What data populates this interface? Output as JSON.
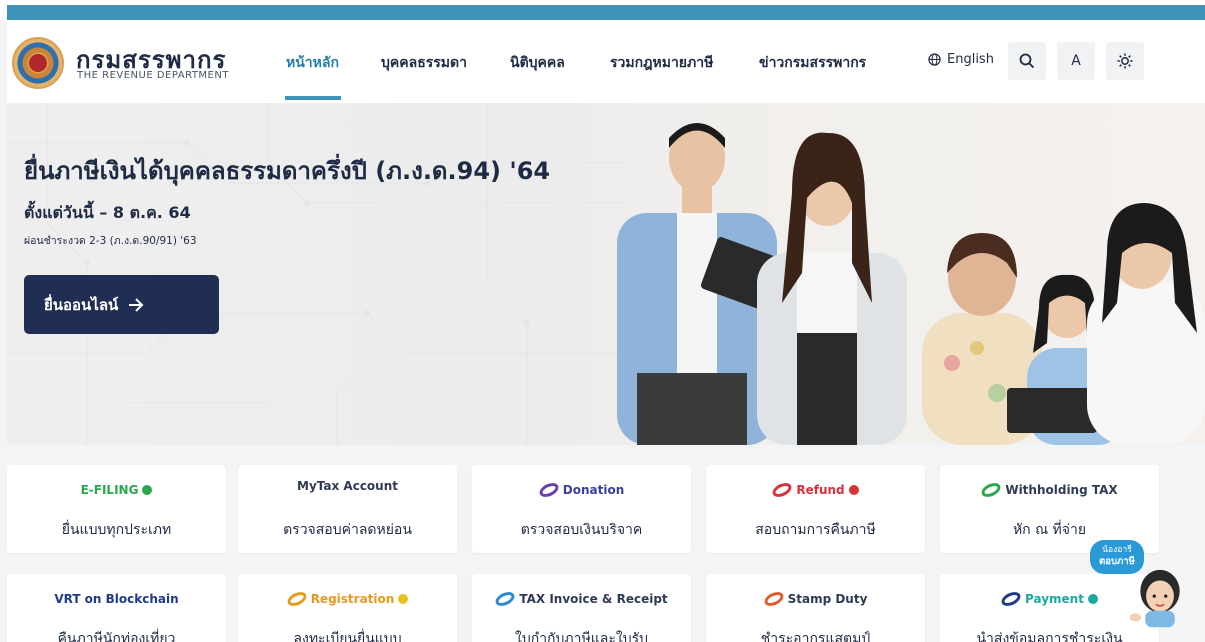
{
  "header": {
    "brand_th": "กรมสรรพากร",
    "brand_en": "THE REVENUE DEPARTMENT",
    "nav": [
      {
        "label": "หน้าหลัก",
        "active": true
      },
      {
        "label": "บุคคลธรรมดา",
        "active": false
      },
      {
        "label": "นิติบุคคล",
        "active": false
      },
      {
        "label": "รวมกฎหมายภาษี",
        "active": false
      },
      {
        "label": "ข่าวกรมสรรพากร",
        "active": false
      }
    ],
    "language_label": "English",
    "font_size_label": "A",
    "icons": [
      "globe-icon",
      "search-icon",
      "brightness-icon"
    ]
  },
  "hero": {
    "title": "ยื่นภาษีเงินได้บุคคลธรรมดาครึ่งปี (ภ.ง.ด.94) '64",
    "subtitle": "ตั้งแต่วันนี้ – 8 ต.ค. 64",
    "note": "ผ่อนชำระงวด 2-3 (ภ.ง.ด.90/91) '63",
    "cta_label": "ยื่นออนไลน์",
    "cta_icon": "arrow-right-icon"
  },
  "services": [
    {
      "brand": "E-FILING",
      "label": "ยื่นแบบทุกประเภท",
      "accent": "#2aa84a"
    },
    {
      "brand": "MyTax Account",
      "label": "ตรวจสอบค่าลดหย่อน",
      "accent": "#e0534a"
    },
    {
      "brand": "Donation",
      "label": "ตรวจสอบเงินบริจาค",
      "accent": "#6a3fa8"
    },
    {
      "brand": "Refund",
      "label": "สอบถามการคืนภาษี",
      "accent": "#d8323a"
    },
    {
      "brand": "Withholding TAX",
      "label": "หัก ณ ที่จ่าย",
      "accent": "#2aa84a"
    },
    {
      "brand": "VRT on Blockchain",
      "label": "คืนภาษีนักท่องเที่ยว",
      "accent": "#1f3a8a"
    },
    {
      "brand": "Registration",
      "label": "ลงทะเบียนยื่นแบบ",
      "accent": "#e89a20"
    },
    {
      "brand": "TAX Invoice & Receipt",
      "label": "ใบกำกับภาษีและใบรับ",
      "accent": "#2a8ad6"
    },
    {
      "brand": "Stamp Duty",
      "label": "ชำระอากรแสตมป์",
      "accent": "#e05a2a"
    },
    {
      "brand": "Payment",
      "label": "นำส่งข้อมูลการชำระเงิน",
      "accent": "#1aa8a0"
    }
  ],
  "mascot": {
    "line1": "น้องอารี",
    "line2": "ตอบภาษี"
  },
  "colors": {
    "primary": "#1f2e52",
    "accent": "#3d93b9",
    "background": "#f3f4f6"
  }
}
